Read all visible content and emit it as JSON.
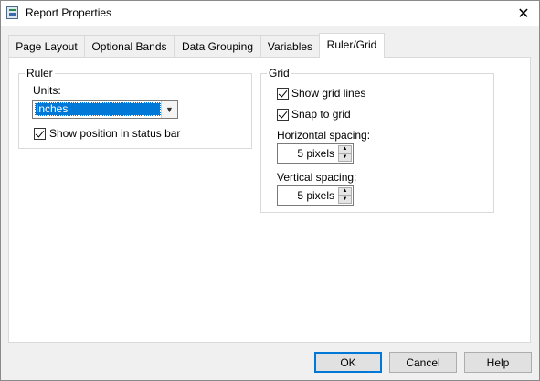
{
  "window": {
    "title": "Report Properties",
    "app_icon": "report-icon",
    "close_glyph": "✕"
  },
  "tabs": [
    {
      "label": "Page Layout"
    },
    {
      "label": "Optional Bands"
    },
    {
      "label": "Data Grouping"
    },
    {
      "label": "Variables"
    },
    {
      "label": "Ruler/Grid"
    }
  ],
  "active_tab": "Ruler/Grid",
  "ruler": {
    "group_label": "Ruler",
    "units_label": "Units:",
    "units_value": "Inches",
    "show_position_label": "Show position in status bar",
    "show_position_checked": true
  },
  "grid": {
    "group_label": "Grid",
    "show_grid_label": "Show grid lines",
    "show_grid_checked": true,
    "snap_label": "Snap to grid",
    "snap_checked": true,
    "horizontal_label": "Horizontal spacing:",
    "horizontal_value": "5 pixels",
    "vertical_label": "Vertical spacing:",
    "vertical_value": "5 pixels"
  },
  "buttons": {
    "ok": "OK",
    "cancel": "Cancel",
    "help": "Help"
  },
  "colors": {
    "accent": "#0078d7",
    "window_bg": "#f0f0f0",
    "panel_bg": "#ffffff"
  }
}
